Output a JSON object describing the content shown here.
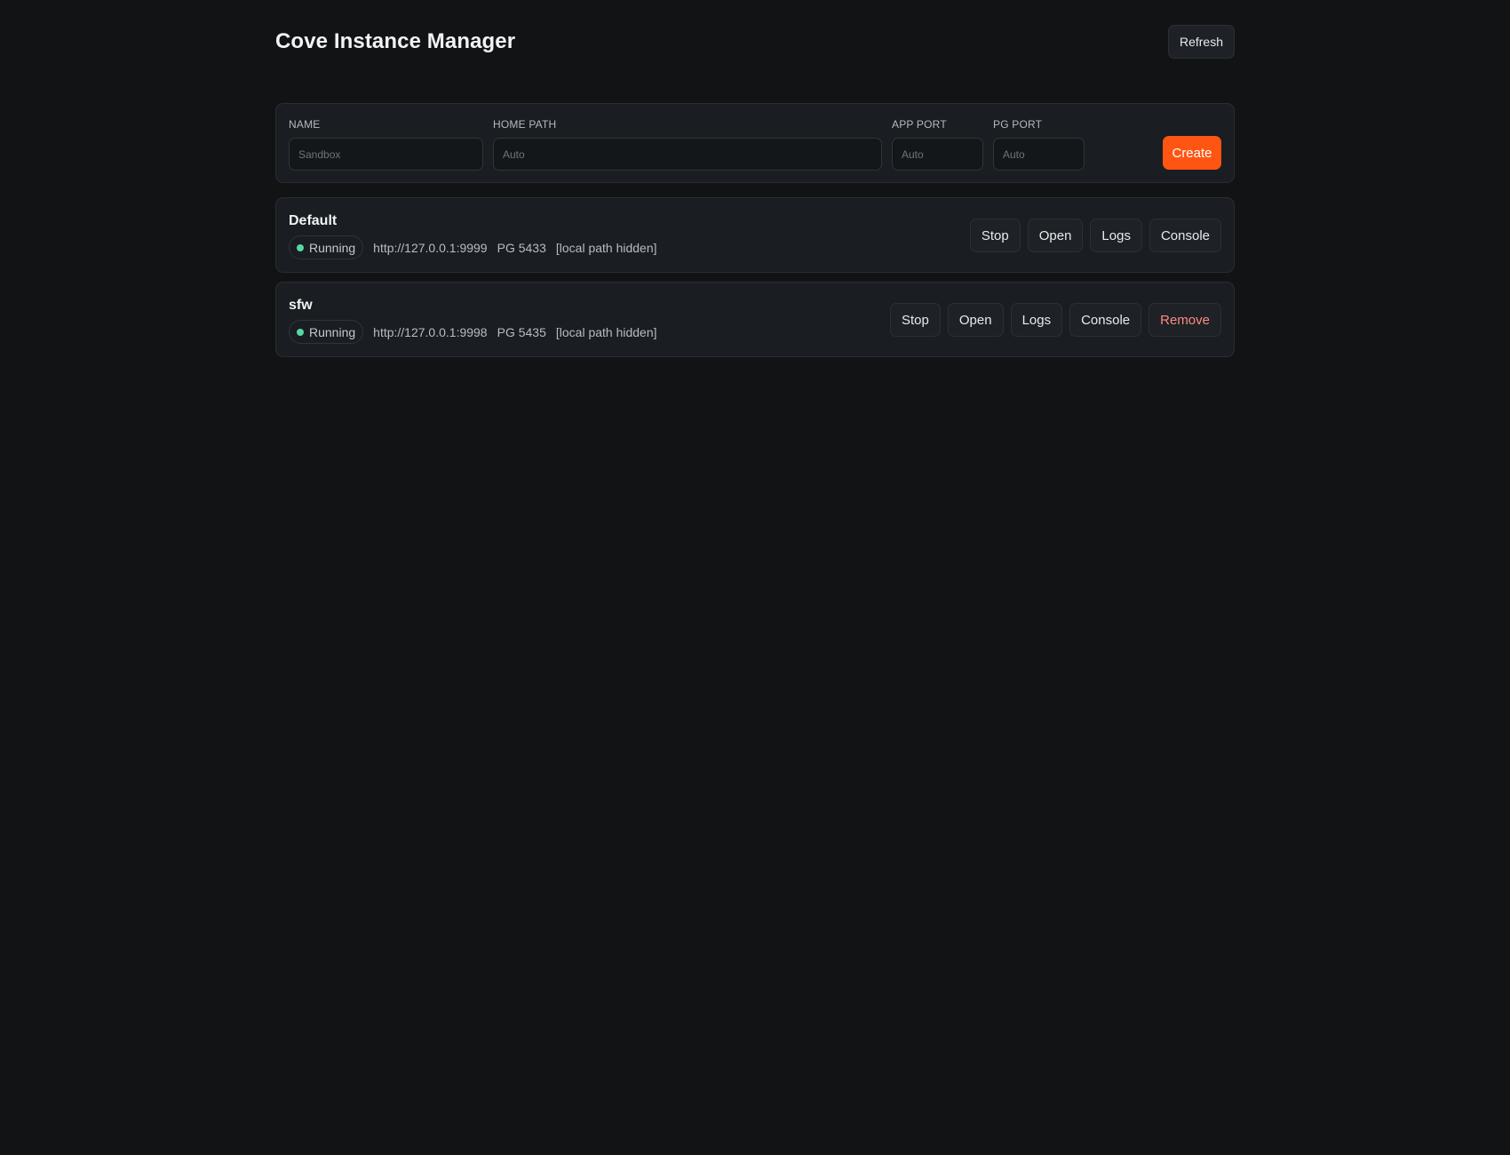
{
  "app": {
    "title": "Cove Instance Manager",
    "refresh_label": "Refresh"
  },
  "create_form": {
    "name": {
      "label": "NAME",
      "placeholder": "Sandbox",
      "value": ""
    },
    "home_path": {
      "label": "HOME PATH",
      "placeholder": "Auto",
      "value": ""
    },
    "app_port": {
      "label": "APP PORT",
      "placeholder": "Auto",
      "value": ""
    },
    "pg_port": {
      "label": "PG PORT",
      "placeholder": "Auto",
      "value": ""
    },
    "create_label": "Create"
  },
  "instances": [
    {
      "name": "Default",
      "status": "Running",
      "url": "http://127.0.0.1:9999",
      "pg": "PG 5433",
      "path": "[local path hidden]",
      "actions": {
        "stop": "Stop",
        "open": "Open",
        "logs": "Logs",
        "console": "Console"
      }
    },
    {
      "name": "sfw",
      "status": "Running",
      "url": "http://127.0.0.1:9998",
      "pg": "PG 5435",
      "path": "[local path hidden]",
      "actions": {
        "stop": "Stop",
        "open": "Open",
        "logs": "Logs",
        "console": "Console",
        "remove": "Remove"
      }
    }
  ],
  "colors": {
    "background": "#111315",
    "card": "#1a1d21",
    "accent": "#ff5512",
    "status_running": "#56d8a3",
    "danger_text": "#ff8a80"
  }
}
